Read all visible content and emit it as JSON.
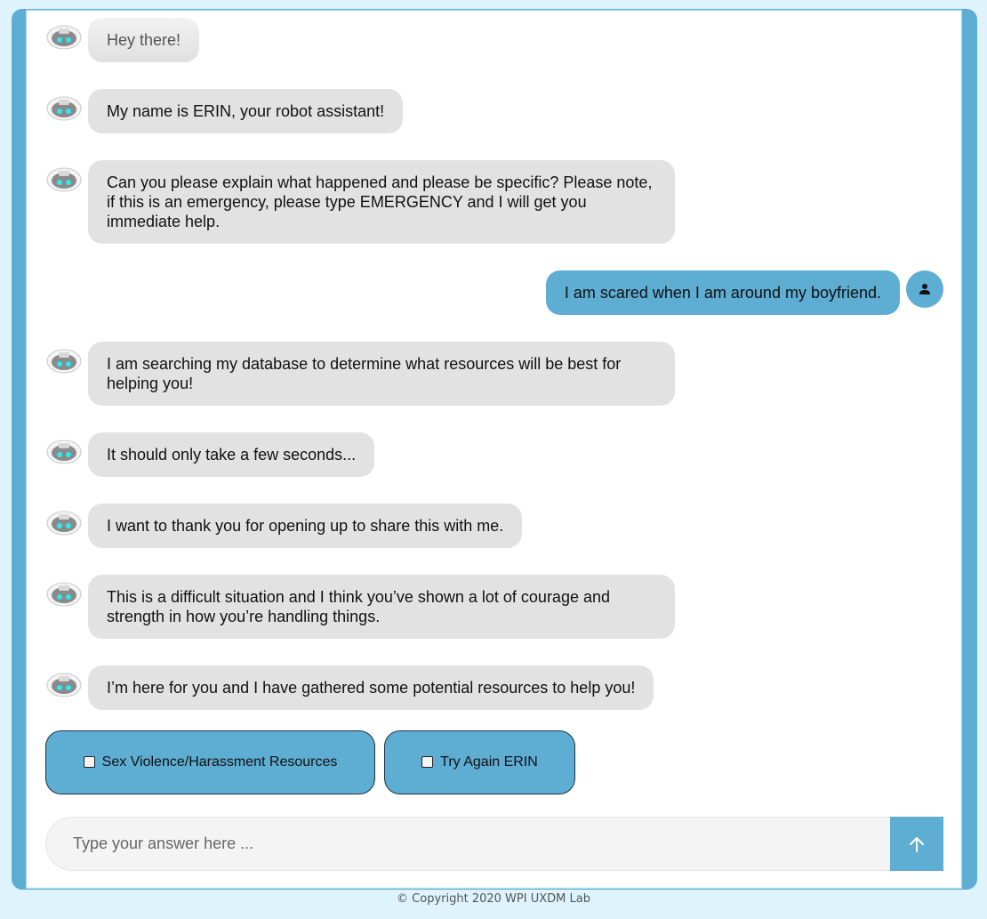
{
  "chat": {
    "messages": [
      {
        "sender": "bot",
        "text": "Hey there!"
      },
      {
        "sender": "bot",
        "text": "My name is ERIN, your robot assistant!"
      },
      {
        "sender": "bot",
        "text": "Can you please explain what happened and please be specific? Please note, if this is an emergency, please type EMERGENCY and I will get you immediate help."
      },
      {
        "sender": "user",
        "text": "I am scared when I am around my boyfriend."
      },
      {
        "sender": "bot",
        "text": "I am searching my database to determine what resources will be best for helping you!"
      },
      {
        "sender": "bot",
        "text": "It should only take a few seconds..."
      },
      {
        "sender": "bot",
        "text": "I want to thank you for opening up to share this with me."
      },
      {
        "sender": "bot",
        "text": "This is a difficult situation and I think you’ve shown a lot of courage and strength in how you’re handling things."
      },
      {
        "sender": "bot",
        "text": "I’m here for you and I have gathered some potential resources to help you!"
      }
    ],
    "options": [
      {
        "label": "Sex Violence/Harassment Resources",
        "checked": false
      },
      {
        "label": "Try Again ERIN",
        "checked": false
      }
    ]
  },
  "input": {
    "placeholder": "Type your answer here ...",
    "value": ""
  },
  "icons": {
    "bot_avatar": "robot-icon",
    "user_avatar": "user-icon",
    "send": "arrow-up-icon"
  },
  "colors": {
    "accent": "#5eadd2",
    "bot_bubble": "#e2e2e2",
    "page_bg": "#dff3fd"
  },
  "footer": {
    "copyright": "© Copyright 2020 WPI UXDM Lab"
  }
}
